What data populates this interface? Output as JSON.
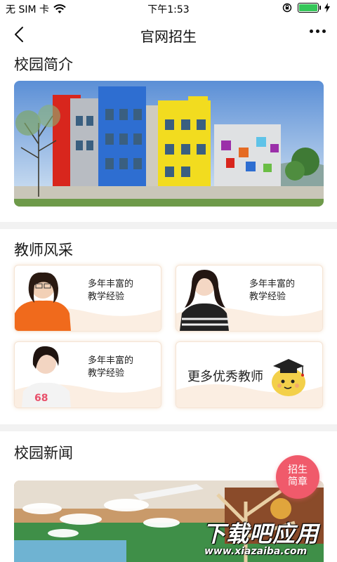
{
  "status_bar": {
    "carrier": "无 SIM 卡",
    "time": "下午1:53",
    "battery_level": 1.0,
    "icons": [
      "wifi-icon",
      "orientation-lock-icon",
      "battery-icon",
      "charging-icon"
    ]
  },
  "nav": {
    "title": "官网招生",
    "back_icon": "chevron-left-icon",
    "more_icon": "more-dots-icon"
  },
  "sections": {
    "intro_title": "校园简介",
    "teachers_title": "教师风采",
    "news_title": "校园新闻"
  },
  "teachers": [
    {
      "desc_line1": "多年丰富的",
      "desc_line2": "教学经验"
    },
    {
      "desc_line1": "多年丰富的",
      "desc_line2": "教学经验"
    },
    {
      "desc_line1": "多年丰富的",
      "desc_line2": "教学经验"
    }
  ],
  "more_teachers": {
    "label": "更多优秀教师"
  },
  "enroll_badge": {
    "line1": "招生",
    "line2": "简章"
  },
  "watermark": {
    "main": "下载吧应用",
    "sub": "www.xiazaiba.com"
  },
  "colors": {
    "accent_badge": "#f05a6b",
    "card_border": "#f5e4d4",
    "divider": "#f2f2f2",
    "battery": "#35c759"
  }
}
